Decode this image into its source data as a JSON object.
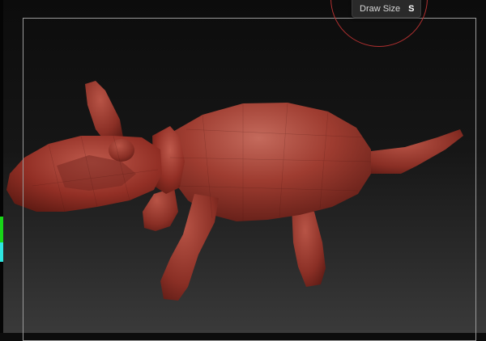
{
  "tooltip": {
    "label": "Draw Size",
    "shortcut": "S"
  },
  "colors": {
    "background_top": "#0c0c0c",
    "background_bottom": "#3a3a3a",
    "model_base": "#9a3a2e",
    "brush_circle": "#b03030",
    "frame": "#9a9a9a",
    "indicator": "#18d618"
  }
}
